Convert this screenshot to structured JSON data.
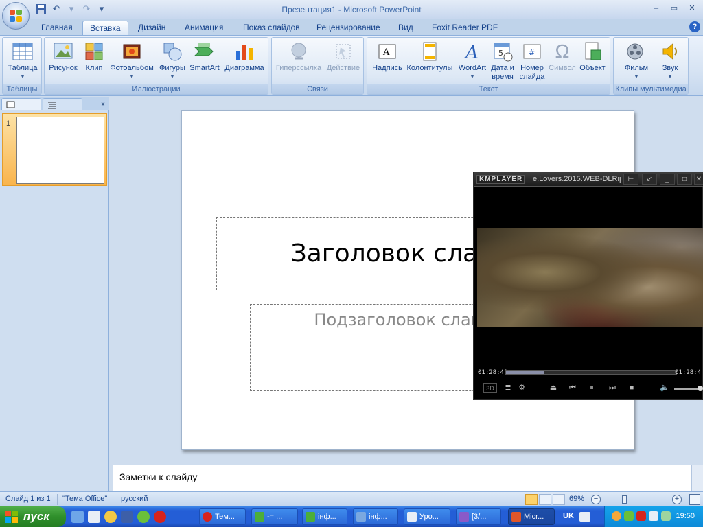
{
  "window": {
    "title": "Презентация1 - Microsoft PowerPoint",
    "minimize": "–",
    "restore": "▭",
    "close": "✕"
  },
  "qat": {
    "save": "save-icon",
    "undo": "undo-icon",
    "redo": "redo-icon",
    "customize": "▾"
  },
  "tabs": [
    "Главная",
    "Вставка",
    "Дизайн",
    "Анимация",
    "Показ слайдов",
    "Рецензирование",
    "Вид",
    "Foxit Reader PDF"
  ],
  "active_tab": "Вставка",
  "ribbon": {
    "groups": {
      "tables": "Таблицы",
      "illustrations": "Иллюстрации",
      "links": "Связи",
      "text": "Текст",
      "media": "Клипы мультимедиа"
    },
    "buttons": {
      "table": "Таблица",
      "picture": "Рисунок",
      "clip": "Клип",
      "album": "Фотоальбом",
      "shapes": "Фигуры",
      "smartart": "SmartArt",
      "chart": "Диаграмма",
      "hyperlink": "Гиперссылка",
      "action": "Действие",
      "textbox": "Надпись",
      "headerfooter": "Колонтитулы",
      "wordart": "WordArt",
      "datetime": "Дата и время",
      "slidenum": "Номер слайда",
      "symbol": "Символ",
      "object": "Объект",
      "movie": "Фильм",
      "sound": "Звук"
    }
  },
  "left_pane": {
    "close": "x",
    "slide_number": "1"
  },
  "slide": {
    "title": "Заголовок слайда",
    "subtitle": "Подзаголовок слайда"
  },
  "notes": {
    "text": "Заметки к слайду"
  },
  "status": {
    "slide": "Слайд 1 из 1",
    "theme": "\"Тема Office\"",
    "language": "русский",
    "zoom": "69%",
    "zoom_minus": "−",
    "zoom_plus": "+"
  },
  "kmplayer": {
    "logo": "KMPLAYER",
    "file": "e.Lovers.2015.WEB-DLRip.",
    "time_left": "01:28:41",
    "time_right": "01:28:4",
    "progress_fraction": 0.22
  },
  "taskbar": {
    "start": "пуск",
    "items": [
      "Тем...",
      "-= ...",
      "інф...",
      "інф...",
      "Уро...",
      "[3/...",
      "Micr..."
    ],
    "lang": "UK",
    "clock": "19:50"
  },
  "colors": {
    "ribbon_bg": "#d6e3f3",
    "active_thumb": "#f9b44c",
    "taskbar": "#245ed6",
    "start": "#2f8f2b"
  }
}
